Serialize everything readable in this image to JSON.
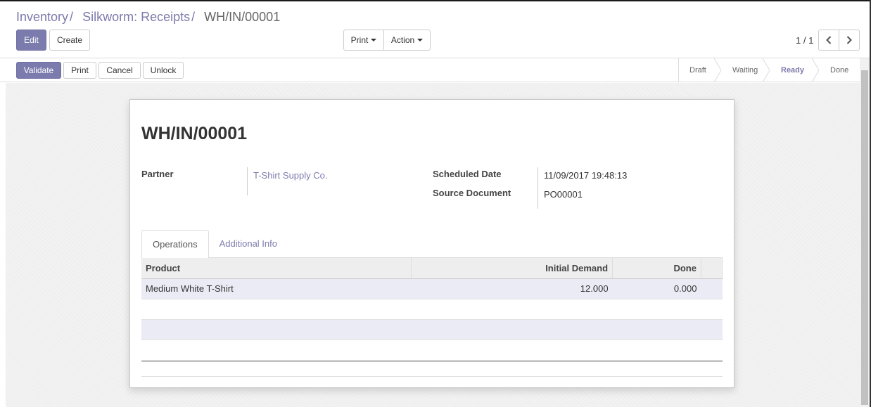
{
  "breadcrumb": {
    "items": [
      "Inventory",
      "Silkworm: Receipts"
    ],
    "separator": "/",
    "current": "WH/IN/00001"
  },
  "toolbar": {
    "edit_label": "Edit",
    "create_label": "Create",
    "print_label": "Print",
    "action_label": "Action"
  },
  "pager": {
    "value": "1 / 1",
    "prev_icon": "chevron-left-icon",
    "next_icon": "chevron-right-icon"
  },
  "statusbar": {
    "buttons": {
      "validate": "Validate",
      "print": "Print",
      "cancel": "Cancel",
      "unlock": "Unlock"
    },
    "steps": [
      "Draft",
      "Waiting",
      "Ready",
      "Done"
    ],
    "active_step": "Ready"
  },
  "form": {
    "title": "WH/IN/00001",
    "partner_label": "Partner",
    "partner_value": "T-Shirt Supply Co.",
    "scheduled_date_label": "Scheduled Date",
    "scheduled_date_value": "11/09/2017 19:48:13",
    "source_document_label": "Source Document",
    "source_document_value": "PO00001"
  },
  "tabs": {
    "operations": "Operations",
    "additional_info": "Additional Info",
    "active": "Operations"
  },
  "operations_table": {
    "columns": [
      "Product",
      "Initial Demand",
      "Done"
    ],
    "rows": [
      {
        "product": "Medium White T-Shirt",
        "initial_demand": "12.000",
        "done": "0.000"
      }
    ]
  },
  "colors": {
    "accent": "#7c7bad",
    "row_highlight": "#ebebf5",
    "header_bg": "#eeeeee"
  }
}
